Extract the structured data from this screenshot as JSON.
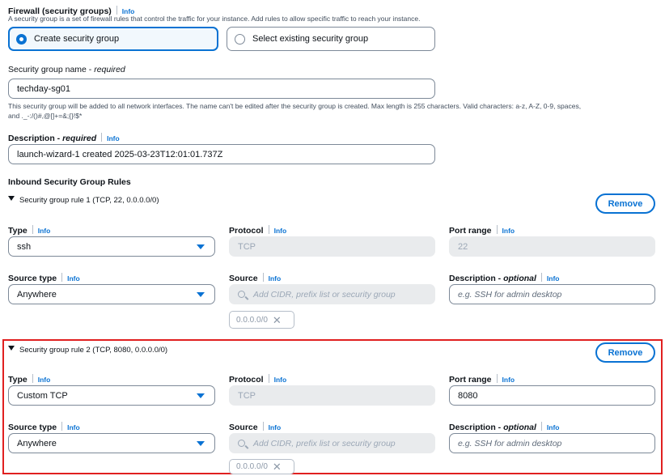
{
  "firewall": {
    "title": "Firewall (security groups)",
    "info": "Info",
    "description": "A security group is a set of firewall rules that control the traffic for your instance. Add rules to allow specific traffic to reach your instance.",
    "option_create": "Create security group",
    "option_select": "Select existing security group"
  },
  "sg_name": {
    "label": "Security group name - ",
    "label_required": "required",
    "value": "techday-sg01",
    "help_line1": "This security group will be added to all network interfaces. The name can't be edited after the security group is created. Max length is 255 characters. Valid characters: a-z, A-Z, 0-9, spaces,",
    "help_line2": "and ._-:/()#,@[]+=&;{}!$*"
  },
  "description": {
    "label": "Description - ",
    "label_required": "required",
    "info": "Info",
    "value": "launch-wizard-1 created 2025-03-23T12:01:01.737Z"
  },
  "inbound": {
    "title": "Inbound Security Group Rules",
    "rules": [
      {
        "header": "Security group rule 1 (TCP, 22, 0.0.0.0/0)",
        "remove": "Remove",
        "type_label": "Type",
        "type_value": "ssh",
        "protocol_label": "Protocol",
        "protocol_value": "TCP",
        "port_label": "Port range",
        "port_value": "22",
        "source_type_label": "Source type",
        "source_type_value": "Anywhere",
        "source_label": "Source",
        "source_placeholder": "Add CIDR, prefix list or security group",
        "source_token": "0.0.0.0/0",
        "desc_label": "Description - ",
        "desc_optional": "optional",
        "desc_placeholder": "e.g. SSH for admin desktop",
        "info": "Info"
      },
      {
        "header": "Security group rule 2 (TCP, 8080, 0.0.0.0/0)",
        "remove": "Remove",
        "type_label": "Type",
        "type_value": "Custom TCP",
        "protocol_label": "Protocol",
        "protocol_value": "TCP",
        "port_label": "Port range",
        "port_value": "8080",
        "source_type_label": "Source type",
        "source_type_value": "Anywhere",
        "source_label": "Source",
        "source_placeholder": "Add CIDR, prefix list or security group",
        "source_token": "0.0.0.0/0",
        "desc_label": "Description - ",
        "desc_optional": "optional",
        "desc_placeholder": "e.g. SSH for admin desktop",
        "info": "Info"
      }
    ]
  },
  "colors": {
    "accent": "#0972d3",
    "highlight_border": "#e02020"
  }
}
